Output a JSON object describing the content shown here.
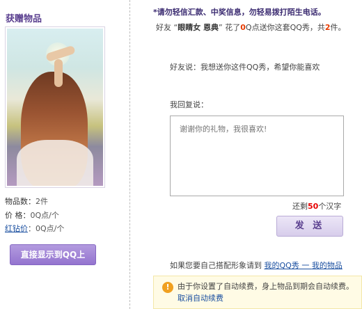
{
  "left": {
    "title": "获赠物品",
    "item_count_label": "物品数：",
    "item_count": "2件",
    "price_label": "价 格：",
    "price": "0Q点/个",
    "diamond_price_label": "红钻价",
    "diamond_price": "：0Q点/个",
    "show_button": "直接显示到QQ上"
  },
  "right": {
    "warning": "*请勿轻信汇款、中奖信息，勿轻易拨打陌生电话。",
    "intro_prefix": "好友 “",
    "friend_name": "眼睛女 恩典",
    "intro_mid": "” 花了",
    "cost": "0",
    "intro_mid2": "Q点送你这套QQ秀，共",
    "count": "2",
    "intro_suffix": "件。",
    "friend_says": "好友说：我想送你这件QQ秀，希望你能喜欢",
    "reply_label": "我回复说：",
    "reply_placeholder": "谢谢你的礼物，我很喜欢!",
    "remain_prefix": "还剩",
    "remain_count": "50",
    "remain_suffix": "个汉字",
    "send_button": "发 送",
    "match_text": "如果您要自己搭配形象请到",
    "my_qqshow_link": "我的QQ秀",
    "dash": " 一 ",
    "my_items_link": "我的物品",
    "notice_text": "由于你设置了自动续费，身上物品到期会自动续费。",
    "cancel_link": "取消自动续费"
  }
}
